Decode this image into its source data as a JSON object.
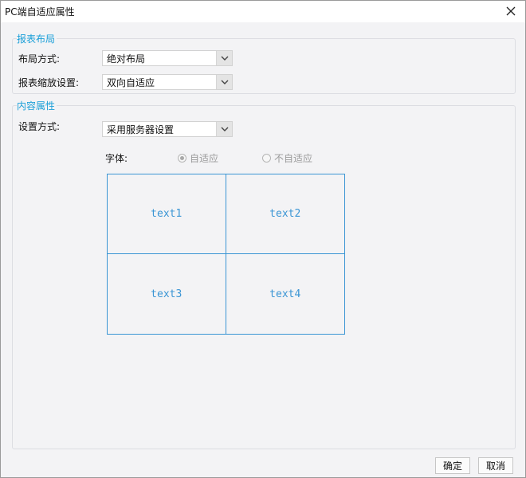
{
  "window": {
    "title": "PC端自适应属性",
    "close_icon": "close-icon"
  },
  "report_layout": {
    "legend": "报表布局",
    "layout_mode": {
      "label": "布局方式:",
      "value": "绝对布局"
    },
    "zoom_setting": {
      "label": "报表缩放设置:",
      "value": "双向自适应"
    }
  },
  "content_props": {
    "legend": "内容属性",
    "setting_mode": {
      "label": "设置方式:",
      "value": "采用服务器设置"
    },
    "font": {
      "label": "字体:",
      "options": [
        {
          "label": "自适应",
          "selected": true
        },
        {
          "label": "不自适应",
          "selected": false
        }
      ]
    },
    "preview_cells": [
      "text1",
      "text2",
      "text3",
      "text4"
    ]
  },
  "footer": {
    "ok_label": "确定",
    "cancel_label": "取消"
  },
  "colors": {
    "accent": "#1a9fd8",
    "preview": "#3a95d4"
  }
}
